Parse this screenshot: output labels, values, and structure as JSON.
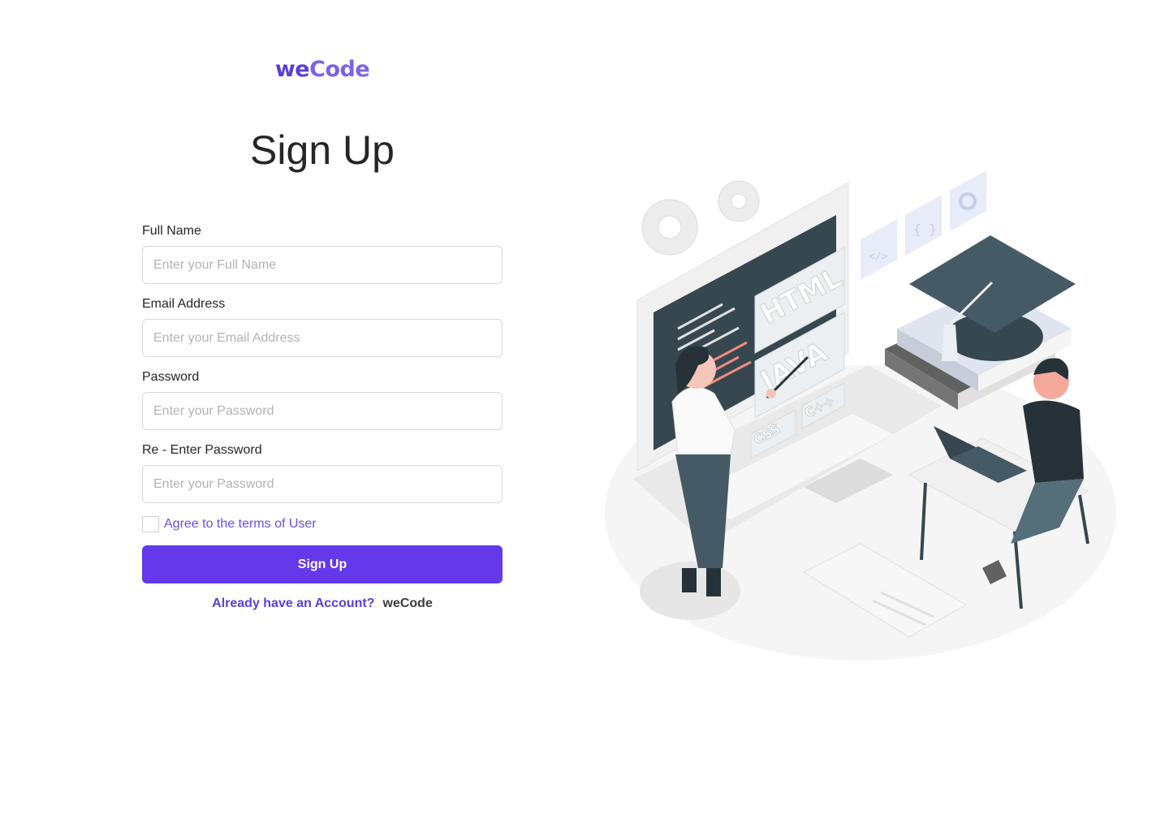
{
  "brand": {
    "logo_part1": "we",
    "logo_part2": "Code"
  },
  "form": {
    "title": "Sign Up",
    "fields": [
      {
        "label": "Full Name",
        "placeholder": "Enter your Full Name"
      },
      {
        "label": "Email Address",
        "placeholder": "Enter your Email Address"
      },
      {
        "label": "Password",
        "placeholder": "Enter your Password"
      },
      {
        "label": "Re - Enter Password",
        "placeholder": "Enter your Password"
      }
    ],
    "terms_label": "Agree to the terms of User",
    "submit_label": "Sign Up",
    "login_prompt": "Already have an Account?",
    "login_brand": "weCode"
  },
  "illustration": {
    "monitor_labels": [
      "HTML",
      "JAVA",
      "CSS",
      "C++"
    ],
    "icon_tiles": [
      "</>",
      "{ }"
    ]
  },
  "colors": {
    "accent": "#6339e9",
    "link": "#5b3fd6",
    "text": "#262626",
    "placeholder": "#b3b3b3",
    "border": "#d9d9d9"
  }
}
